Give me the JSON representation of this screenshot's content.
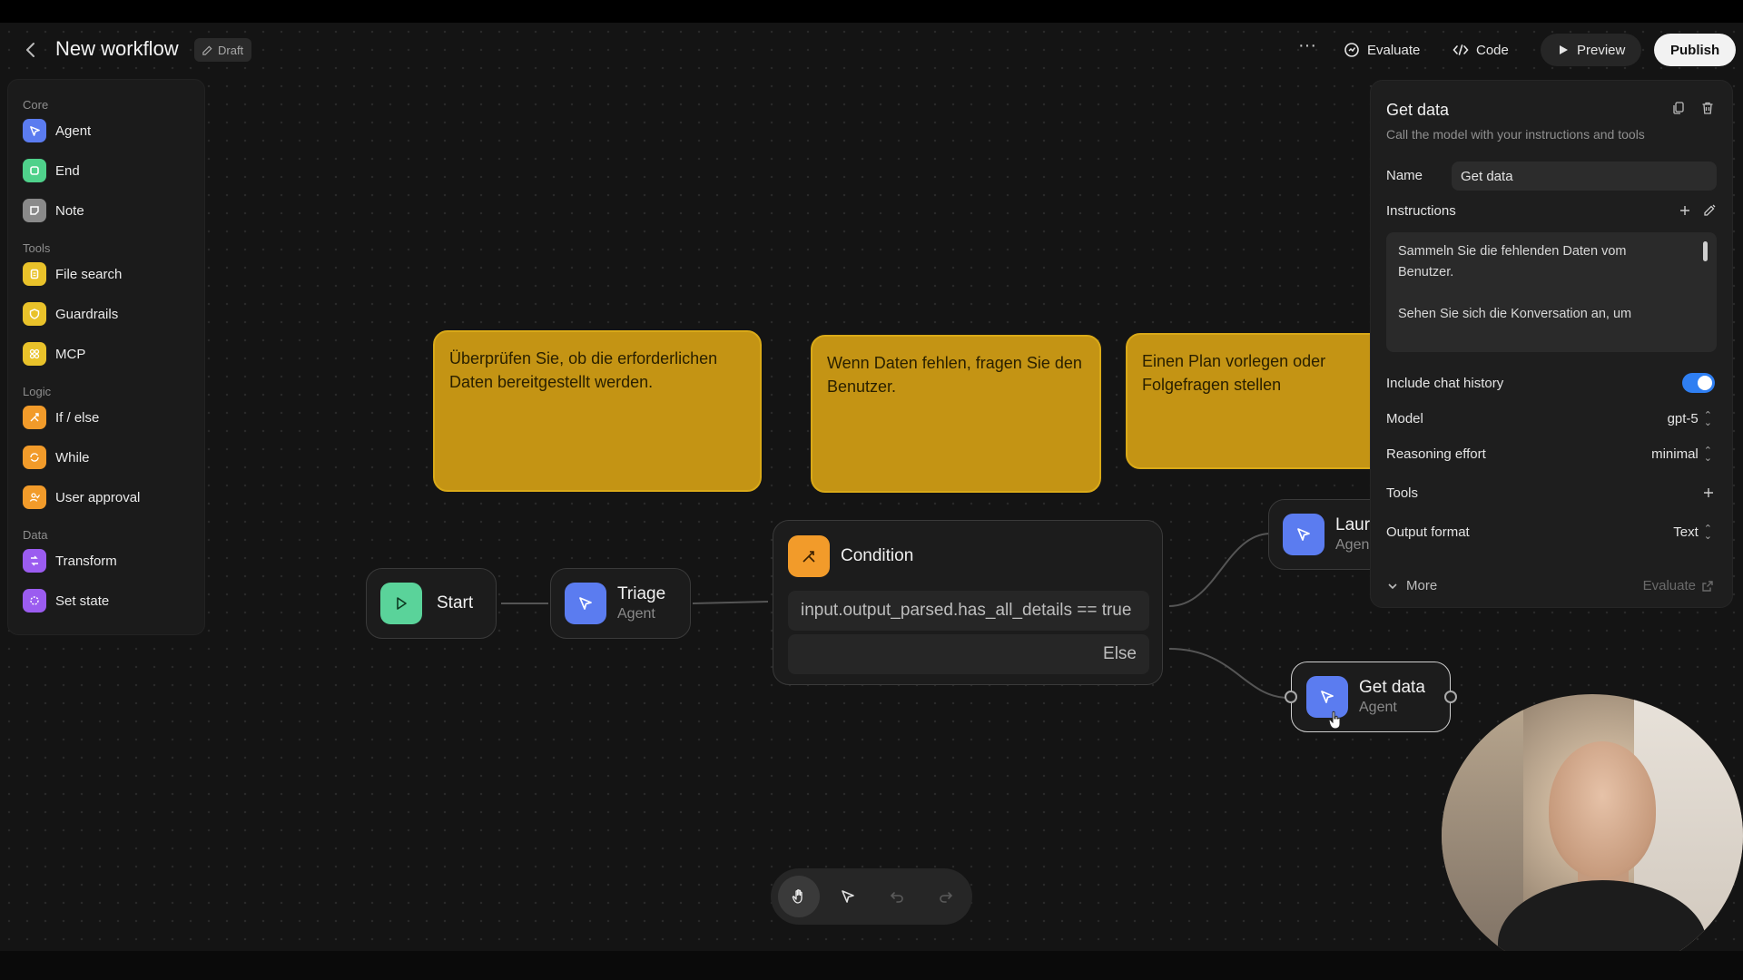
{
  "header": {
    "title": "New workflow",
    "draft": "Draft",
    "actions": {
      "evaluate": "Evaluate",
      "code": "Code",
      "preview": "Preview",
      "publish": "Publish"
    }
  },
  "palette": {
    "sections": [
      {
        "label": "Core",
        "items": [
          {
            "label": "Agent",
            "icon": "agent-icon",
            "color": "#5b7cf0"
          },
          {
            "label": "End",
            "icon": "end-icon",
            "color": "#4fd18b"
          },
          {
            "label": "Note",
            "icon": "note-icon",
            "color": "#8a8a8a"
          }
        ]
      },
      {
        "label": "Tools",
        "items": [
          {
            "label": "File search",
            "icon": "file-search-icon",
            "color": "#e9c22a"
          },
          {
            "label": "Guardrails",
            "icon": "guardrails-icon",
            "color": "#e9c22a"
          },
          {
            "label": "MCP",
            "icon": "mcp-icon",
            "color": "#e9c22a"
          }
        ]
      },
      {
        "label": "Logic",
        "items": [
          {
            "label": "If / else",
            "icon": "if-else-icon",
            "color": "#f29b2a"
          },
          {
            "label": "While",
            "icon": "while-icon",
            "color": "#f29b2a"
          },
          {
            "label": "User approval",
            "icon": "user-approval-icon",
            "color": "#f29b2a"
          }
        ]
      },
      {
        "label": "Data",
        "items": [
          {
            "label": "Transform",
            "icon": "transform-icon",
            "color": "#9b5cf0"
          },
          {
            "label": "Set state",
            "icon": "set-state-icon",
            "color": "#9b5cf0"
          }
        ]
      }
    ]
  },
  "canvas": {
    "notes": [
      "Überprüfen Sie, ob die erforderlichen Daten bereitgestellt werden.",
      "Wenn Daten fehlen, fragen Sie den Benutzer.",
      "Einen Plan vorlegen oder Folgefragen stellen"
    ],
    "nodes": {
      "start": {
        "title": "Start"
      },
      "triage": {
        "title": "Triage",
        "sub": "Agent"
      },
      "condition": {
        "title": "Condition",
        "expr": "input.output_parsed.has_all_details == true",
        "else": "Else"
      },
      "launch": {
        "title": "Laur",
        "sub": "Agen"
      },
      "getdata": {
        "title": "Get data",
        "sub": "Agent"
      }
    }
  },
  "panel": {
    "title": "Get data",
    "description": "Call the model with your instructions and tools",
    "name_label": "Name",
    "name_value": "Get data",
    "instructions_label": "Instructions",
    "instructions_p1": "Sammeln Sie die fehlenden Daten vom Benutzer.",
    "instructions_p2": "Sehen Sie sich die Konversation an, um",
    "chat_history_label": "Include chat history",
    "chat_history_on": true,
    "model_label": "Model",
    "model_value": "gpt-5",
    "reasoning_label": "Reasoning effort",
    "reasoning_value": "minimal",
    "tools_label": "Tools",
    "output_label": "Output format",
    "output_value": "Text",
    "more": "More",
    "evaluate": "Evaluate"
  }
}
